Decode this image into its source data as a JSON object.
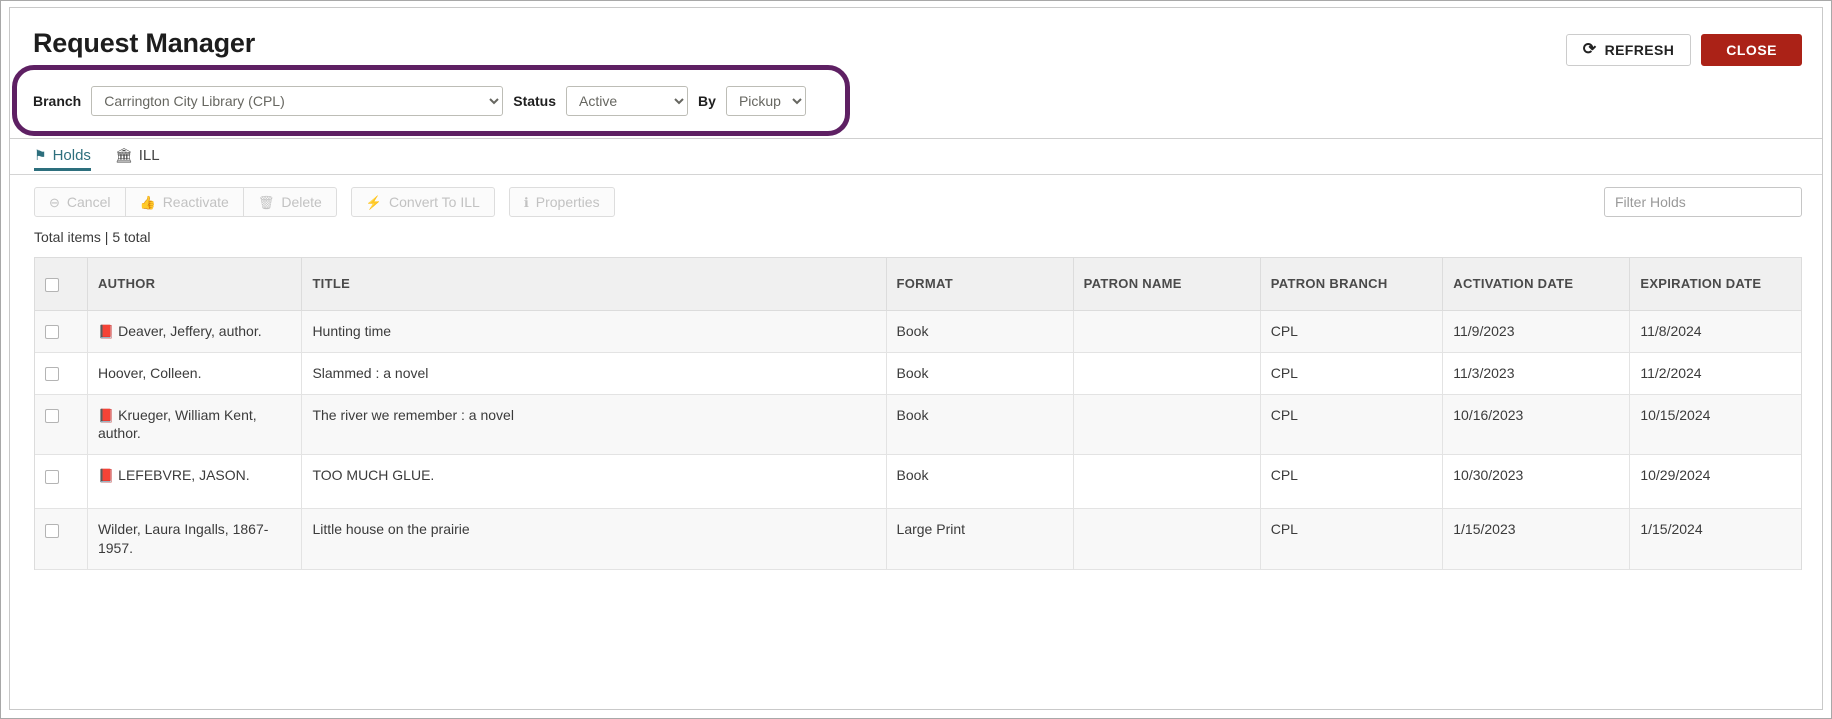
{
  "header": {
    "title": "Request Manager",
    "refresh_label": "REFRESH",
    "refresh_icon": "refresh-circular-arrow",
    "close_label": "CLOSE",
    "close_color": "#ab2217"
  },
  "filters": {
    "highlight_color": "#5e2063",
    "branch_label": "Branch",
    "branch_value": "Carrington City Library (CPL)",
    "status_label": "Status",
    "status_value": "Active",
    "by_label": "By",
    "by_value": "Pickup"
  },
  "tabs": {
    "accent_color": "#2d6f7d",
    "items": [
      {
        "label": "Holds",
        "icon": "flag-icon",
        "glyph": "⚑",
        "active": true
      },
      {
        "label": "ILL",
        "icon": "library-building-icon",
        "glyph": "🏛",
        "active": false
      }
    ]
  },
  "toolbar": {
    "buttons": [
      {
        "label": "Cancel",
        "icon": "minus-circle-icon",
        "glyph": "⊖",
        "disabled": true
      },
      {
        "label": "Reactivate",
        "icon": "thumbs-up-icon",
        "glyph": "👍",
        "disabled": true
      },
      {
        "label": "Delete",
        "icon": "trash-icon",
        "glyph": "🗑",
        "disabled": true
      },
      {
        "label": "Convert To ILL",
        "icon": "lightning-bolt-icon",
        "glyph": "⚡",
        "disabled": true
      },
      {
        "label": "Properties",
        "icon": "info-circle-icon",
        "glyph": "ℹ",
        "disabled": true
      }
    ],
    "filter_placeholder": "Filter Holds",
    "filter_value": ""
  },
  "summary": {
    "total_text": "Total items | 5 total"
  },
  "table": {
    "columns": [
      "AUTHOR",
      "TITLE",
      "FORMAT",
      "PATRON NAME",
      "PATRON BRANCH",
      "ACTIVATION DATE",
      "EXPIRATION DATE"
    ],
    "rows": [
      {
        "has_book_icon": true,
        "author": "Deaver, Jeffery, author.",
        "title": "Hunting time",
        "format": "Book",
        "patron_name": "",
        "patron_branch": "CPL",
        "activation_date": "11/9/2023",
        "expiration_date": "11/8/2024"
      },
      {
        "has_book_icon": false,
        "author": "Hoover, Colleen.",
        "title": "Slammed : a novel",
        "format": "Book",
        "patron_name": "",
        "patron_branch": "CPL",
        "activation_date": "11/3/2023",
        "expiration_date": "11/2/2024"
      },
      {
        "has_book_icon": true,
        "author": "Krueger, William Kent, author.",
        "title": "The river we remember : a novel",
        "format": "Book",
        "patron_name": "",
        "patron_branch": "CPL",
        "activation_date": "10/16/2023",
        "expiration_date": "10/15/2024"
      },
      {
        "has_book_icon": true,
        "author": "LEFEBVRE, JASON.",
        "title": "TOO MUCH GLUE.",
        "format": "Book",
        "patron_name": "",
        "patron_branch": "CPL",
        "activation_date": "10/30/2023",
        "expiration_date": "10/29/2024"
      },
      {
        "has_book_icon": false,
        "author": "Wilder, Laura Ingalls, 1867-1957.",
        "title": "Little house on the prairie",
        "format": "Large Print",
        "patron_name": "",
        "patron_branch": "CPL",
        "activation_date": "1/15/2023",
        "expiration_date": "1/15/2024"
      }
    ]
  }
}
